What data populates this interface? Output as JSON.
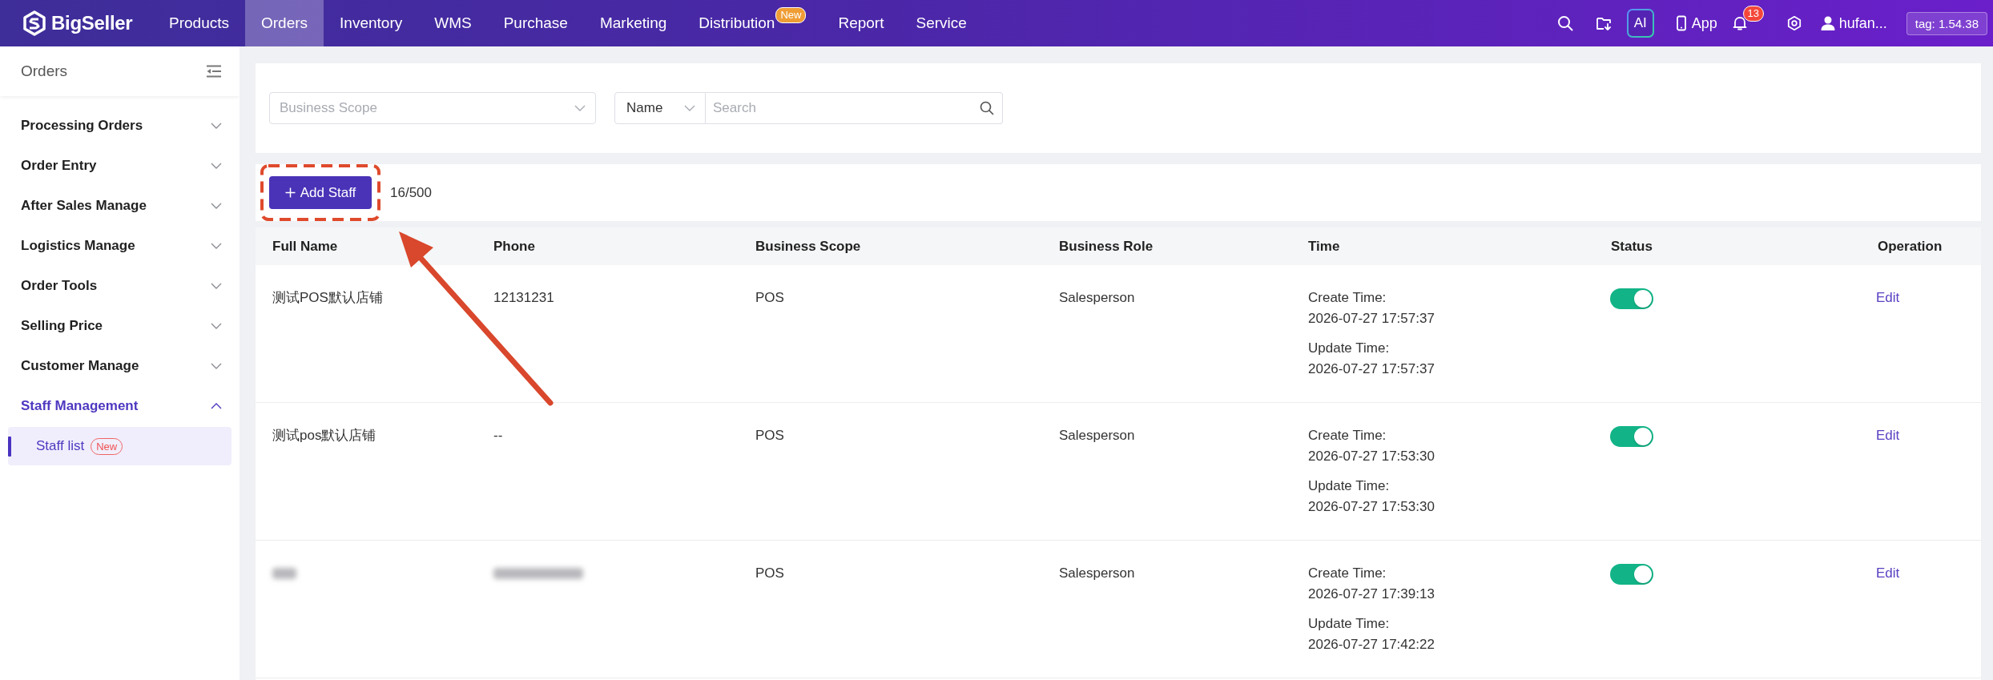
{
  "top_bar": {
    "logo_text": "BigSeller",
    "nav": [
      {
        "label": "Products",
        "selected": false
      },
      {
        "label": "Orders",
        "selected": true
      },
      {
        "label": "Inventory",
        "selected": false
      },
      {
        "label": "WMS",
        "selected": false
      },
      {
        "label": "Purchase",
        "selected": false
      },
      {
        "label": "Marketing",
        "selected": false
      },
      {
        "label": "Distribution",
        "selected": false,
        "badge": "New"
      },
      {
        "label": "Report",
        "selected": false
      },
      {
        "label": "Service",
        "selected": false
      }
    ],
    "ai_button": "AI",
    "app_link": "App",
    "notifications_badge": "13",
    "user_name": "hufan...",
    "version_tag": "tag: 1.54.38"
  },
  "sidebar": {
    "title": "Orders",
    "items": [
      {
        "label": "Processing Orders",
        "expanded": false
      },
      {
        "label": "Order Entry",
        "expanded": false
      },
      {
        "label": "After Sales Manage",
        "expanded": false
      },
      {
        "label": "Logistics Manage",
        "expanded": false
      },
      {
        "label": "Order Tools",
        "expanded": false
      },
      {
        "label": "Selling Price",
        "expanded": false
      },
      {
        "label": "Customer Manage",
        "expanded": false
      },
      {
        "label": "Staff Management",
        "expanded": true,
        "children": [
          {
            "label": "Staff list",
            "selected": true,
            "badge": "New"
          }
        ]
      }
    ]
  },
  "filters": {
    "business_scope": {
      "placeholder": "Business Scope"
    },
    "search_type": {
      "value": "Name"
    },
    "search": {
      "placeholder": "Search"
    }
  },
  "toolbar": {
    "add_button": "Add Staff",
    "count": "16/500"
  },
  "table": {
    "columns": [
      "Full Name",
      "Phone",
      "Business Scope",
      "Business Role",
      "Time",
      "Status",
      "Operation"
    ],
    "rows": [
      {
        "blurred": false,
        "full_name": "测试POS默认店铺",
        "phone": "12131231",
        "business_scope": "POS",
        "business_role": "Salesperson",
        "create_label": "Create Time:",
        "create_time": "2026-07-27 17:57:37",
        "update_label": "Update Time:",
        "update_time": "2026-07-27 17:57:37",
        "enabled": true,
        "edit_link": "Edit"
      },
      {
        "blurred": false,
        "full_name": "测试pos默认店铺",
        "phone": "--",
        "business_scope": "POS",
        "business_role": "Salesperson",
        "create_label": "Create Time:",
        "create_time": "2026-07-27 17:53:30",
        "update_label": "Update Time:",
        "update_time": "2026-07-27 17:53:30",
        "enabled": true,
        "edit_link": "Edit"
      },
      {
        "blurred": true,
        "business_scope": "POS",
        "business_role": "Salesperson",
        "create_label": "Create Time:",
        "create_time": "2026-07-27 17:39:13",
        "update_label": "Update Time:",
        "update_time": "2026-07-27 17:42:22",
        "enabled": true,
        "edit_link": "Edit"
      }
    ]
  }
}
